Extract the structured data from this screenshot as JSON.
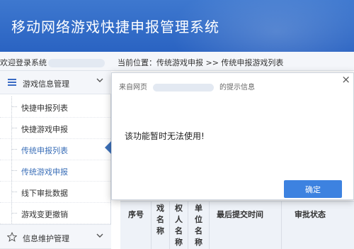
{
  "app": {
    "title": "移动网络游戏快捷申报管理系统"
  },
  "infobar": {
    "welcome": "欢迎登录系统",
    "breadcrumb": "当前位置：传统游戏申报 >> 传统申报游戏列表"
  },
  "sidebar": {
    "groups": [
      {
        "label": "游戏信息管理",
        "icon": "list-icon"
      },
      {
        "label": "信息维护管理",
        "icon": "star-icon"
      }
    ],
    "items": [
      {
        "label": "快捷申报列表"
      },
      {
        "label": "快捷游戏申报"
      },
      {
        "label": "传统申报列表"
      },
      {
        "label": "传统游戏申报"
      },
      {
        "label": "线下审批数据"
      },
      {
        "label": "游戏变更撤销"
      }
    ]
  },
  "table": {
    "headers": [
      "序号",
      "戏名称",
      "权人名称",
      "单位名称",
      "最后提交时间",
      "审批状态"
    ]
  },
  "dialog": {
    "title_prefix": "来自网页",
    "title_suffix": "的提示信息",
    "message": "该功能暂时无法使用!",
    "ok_label": "确定",
    "close_glyph": "×"
  },
  "colors": {
    "header": "#2f6bc8",
    "accent": "#3b6fb8",
    "button": "#3d82e0"
  }
}
